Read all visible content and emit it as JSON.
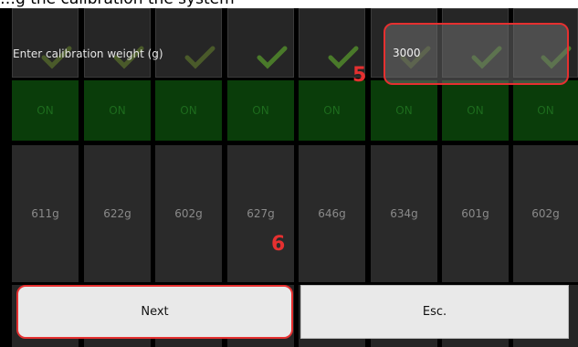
{
  "header": {
    "title": "…g the calibration the system"
  },
  "calibration": {
    "label": "Enter calibration weight (g)",
    "value": "3000"
  },
  "channels": [
    {
      "status": "ON",
      "weight": "611g"
    },
    {
      "status": "ON",
      "weight": "622g"
    },
    {
      "status": "ON",
      "weight": "602g"
    },
    {
      "status": "ON",
      "weight": "627g"
    },
    {
      "status": "ON",
      "weight": "646g"
    },
    {
      "status": "ON",
      "weight": "634g"
    },
    {
      "status": "ON",
      "weight": "601g"
    },
    {
      "status": "ON",
      "weight": "602g"
    }
  ],
  "annotations": {
    "step_input": "5",
    "step_next": "6"
  },
  "buttons": {
    "next_label": "Next",
    "esc_label": "Esc."
  },
  "icons": {
    "check": "check-icon"
  },
  "colors": {
    "highlight": "#e53030",
    "on_tile": "#0a3d0a",
    "on_text": "#1d6b1d"
  }
}
